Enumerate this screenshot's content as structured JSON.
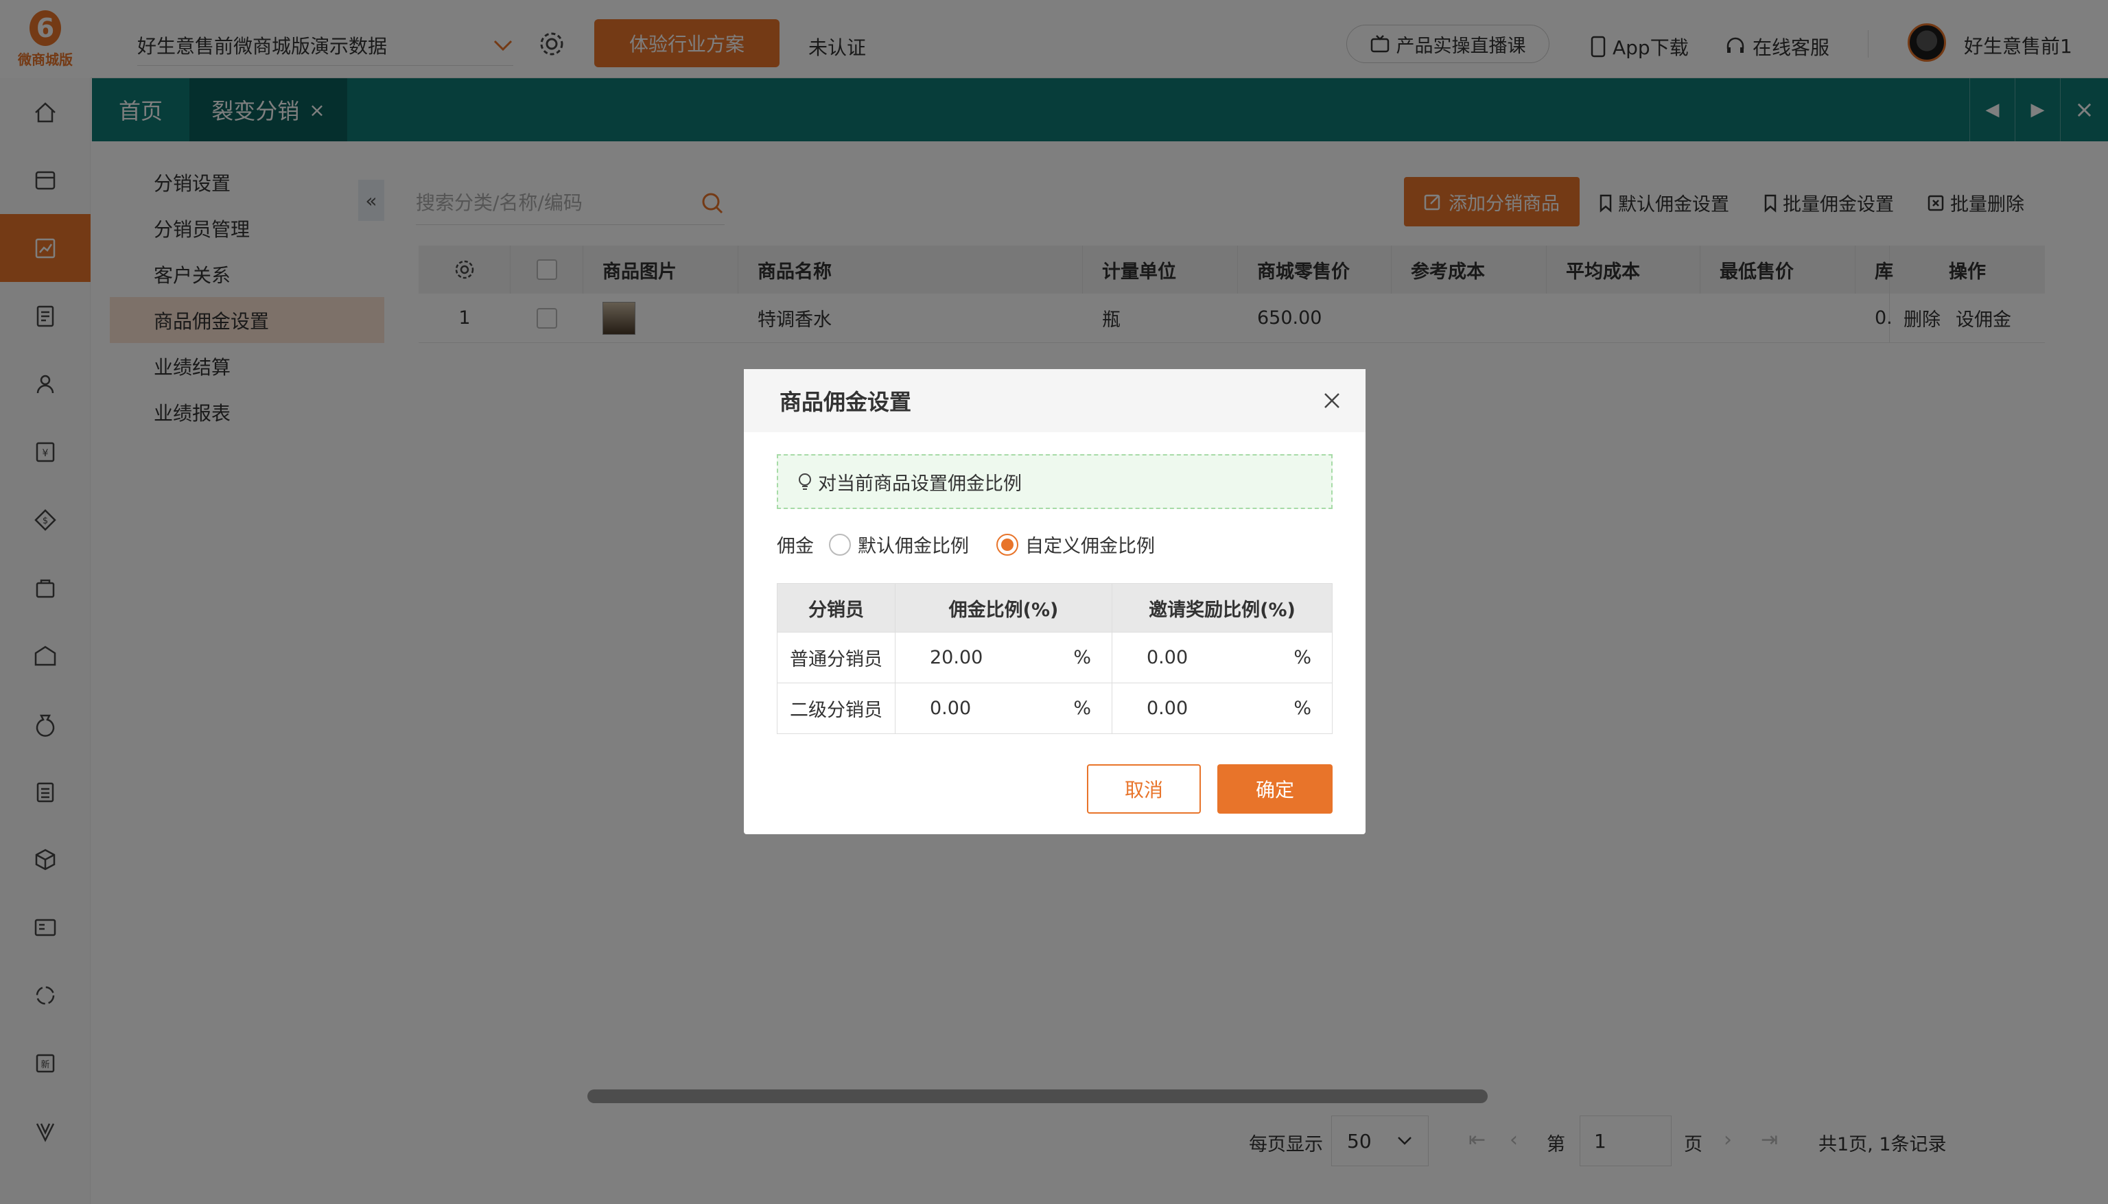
{
  "logo": {
    "mark": "6",
    "text": "微商城版"
  },
  "header": {
    "shop_name": "好生意售前微商城版演示数据",
    "solution_button": "体验行业方案",
    "verify_status": "未认证",
    "live_course": "产品实操直播课",
    "app_download": "App下载",
    "online_service": "在线客服",
    "username": "好生意售前1"
  },
  "tabs": {
    "home": "首页",
    "active": "裂变分销"
  },
  "sidebar": {
    "items": [
      "分销设置",
      "分销员管理",
      "客户关系",
      "商品佣金设置",
      "业绩结算",
      "业绩报表"
    ]
  },
  "toolbar": {
    "search_placeholder": "搜索分类/名称/编码",
    "add_product": "添加分销商品",
    "default_commission": "默认佣金设置",
    "batch_commission": "批量佣金设置",
    "batch_delete": "批量删除"
  },
  "table": {
    "headers": [
      "商品图片",
      "商品名称",
      "计量单位",
      "商城零售价",
      "参考成本",
      "平均成本",
      "最低售价",
      "库",
      "操作"
    ],
    "rows": [
      {
        "index": "1",
        "name": "特调香水",
        "unit": "瓶",
        "price": "650.00",
        "stock": "0.",
        "delete": "删除",
        "set": "设佣金"
      }
    ]
  },
  "pager": {
    "per_page_label": "每页显示",
    "per_page_value": "50",
    "page_prefix": "第",
    "page_value": "1",
    "page_suffix": "页",
    "summary": "共1页, 1条记录"
  },
  "modal": {
    "title": "商品佣金设置",
    "tip": "对当前商品设置佣金比例",
    "commission_label": "佣金",
    "option_default": "默认佣金比例",
    "option_custom": "自定义佣金比例",
    "columns": [
      "分销员",
      "佣金比例(%)",
      "邀请奖励比例(%)"
    ],
    "rows": [
      {
        "role": "普通分销员",
        "rate": "20.00",
        "invite": "0.00"
      },
      {
        "role": "二级分销员",
        "rate": "0.00",
        "invite": "0.00"
      }
    ],
    "percent": "%",
    "cancel": "取消",
    "confirm": "确定"
  },
  "colors": {
    "accent": "#e8742a",
    "tabbar": "#0f7a74"
  }
}
